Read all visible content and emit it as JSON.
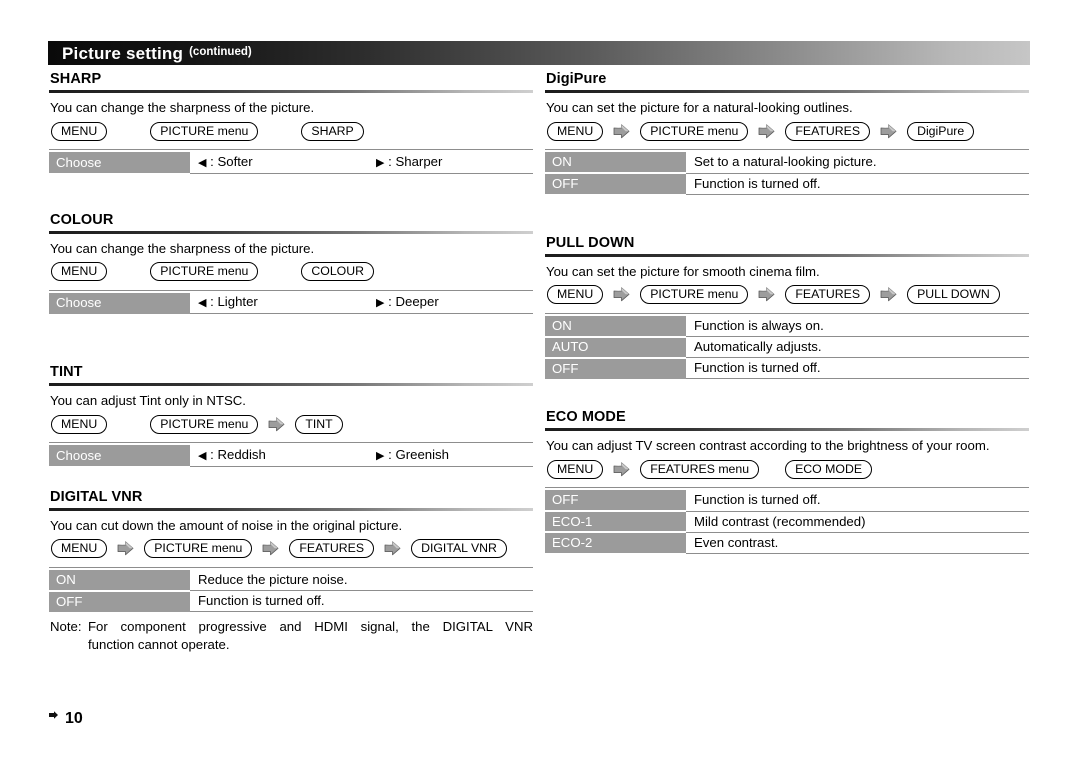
{
  "banner": {
    "title": "Picture setting",
    "subtitle": "(continued)"
  },
  "icons": {
    "arrow": "right-arrow-icon",
    "left_triangle": "◀",
    "right_triangle": "▶",
    "footer_marker": "page-marker-icon"
  },
  "footer": {
    "page_number": "10"
  },
  "left_column": [
    {
      "id": "sharp",
      "heading": "SHARP",
      "description": "You can change the sharpness of the picture.",
      "nav": [
        {
          "label": "MENU",
          "arrow_after": false,
          "gap": "lg"
        },
        {
          "label": "PICTURE menu",
          "arrow_after": false,
          "gap": "lg"
        },
        {
          "label": "SHARP",
          "arrow_after": false,
          "gap": "none"
        }
      ],
      "table_type": "choose",
      "choose_label": "Choose",
      "choose_left": ": Softer",
      "choose_right": ": Sharper"
    },
    {
      "id": "colour",
      "heading": "COLOUR",
      "description": "You can change the sharpness of the picture.",
      "nav": [
        {
          "label": "MENU",
          "arrow_after": false,
          "gap": "lg"
        },
        {
          "label": "PICTURE menu",
          "arrow_after": false,
          "gap": "lg"
        },
        {
          "label": "COLOUR",
          "arrow_after": false,
          "gap": "none"
        }
      ],
      "table_type": "choose",
      "choose_label": "Choose",
      "choose_left": ": Lighter",
      "choose_right": ": Deeper"
    },
    {
      "id": "tint",
      "heading": "TINT",
      "description": "You can adjust Tint only in NTSC.",
      "nav": [
        {
          "label": "MENU",
          "arrow_after": false,
          "gap": "lg"
        },
        {
          "label": "PICTURE menu",
          "arrow_after": true,
          "gap": "sm"
        },
        {
          "label": "TINT",
          "arrow_after": false,
          "gap": "none"
        }
      ],
      "table_type": "choose",
      "choose_label": "Choose",
      "choose_left": ": Reddish",
      "choose_right": ": Greenish"
    },
    {
      "id": "digital-vnr",
      "heading": "DIGITAL VNR",
      "description": "You can cut down the amount of noise in the original picture.",
      "nav": [
        {
          "label": "MENU",
          "arrow_after": true,
          "gap": "sm"
        },
        {
          "label": "PICTURE menu",
          "arrow_after": true,
          "gap": "sm"
        },
        {
          "label": "FEATURES",
          "arrow_after": true,
          "gap": "sm"
        },
        {
          "label": "DIGITAL VNR",
          "arrow_after": false,
          "gap": "none"
        }
      ],
      "table_type": "kv",
      "rows": [
        {
          "key": "ON",
          "value": "Reduce the picture noise."
        },
        {
          "key": "OFF",
          "value": "Function is turned off."
        }
      ],
      "note": {
        "label": "Note:",
        "line1": "For component progressive and HDMI signal, the DIGITAL VNR",
        "line2": "function cannot operate."
      }
    }
  ],
  "right_column": [
    {
      "id": "digipure",
      "heading": "DigiPure",
      "description": "You can set the picture for a natural-looking outlines.",
      "nav": [
        {
          "label": "MENU",
          "arrow_after": true,
          "gap": "sm"
        },
        {
          "label": "PICTURE menu",
          "arrow_after": true,
          "gap": "sm"
        },
        {
          "label": "FEATURES",
          "arrow_after": true,
          "gap": "sm"
        },
        {
          "label": "DigiPure",
          "arrow_after": false,
          "gap": "none"
        }
      ],
      "table_type": "kv",
      "rows": [
        {
          "key": "ON",
          "value": "Set to a natural-looking picture."
        },
        {
          "key": "OFF",
          "value": "Function is turned off."
        }
      ]
    },
    {
      "id": "pull-down",
      "heading": "PULL DOWN",
      "description": "You can set the picture for smooth cinema film.",
      "nav": [
        {
          "label": "MENU",
          "arrow_after": true,
          "gap": "sm"
        },
        {
          "label": "PICTURE menu",
          "arrow_after": true,
          "gap": "sm"
        },
        {
          "label": "FEATURES",
          "arrow_after": true,
          "gap": "sm"
        },
        {
          "label": "PULL DOWN",
          "arrow_after": false,
          "gap": "none"
        }
      ],
      "table_type": "kv",
      "rows": [
        {
          "key": "ON",
          "value": "Function is always on."
        },
        {
          "key": "AUTO",
          "value": "Automatically adjusts."
        },
        {
          "key": "OFF",
          "value": "Function is turned off."
        }
      ]
    },
    {
      "id": "eco-mode",
      "heading": "ECO MODE",
      "description": "You can adjust TV screen contrast according to the brightness of your room.",
      "nav": [
        {
          "label": "MENU",
          "arrow_after": true,
          "gap": "sm"
        },
        {
          "label": "FEATURES menu",
          "arrow_after": false,
          "gap": "md"
        },
        {
          "label": "ECO MODE",
          "arrow_after": false,
          "gap": "none"
        }
      ],
      "table_type": "kv",
      "rows": [
        {
          "key": "OFF",
          "value": "Function is turned off."
        },
        {
          "key": "ECO-1",
          "value": "Mild contrast (recommended)"
        },
        {
          "key": "ECO-2",
          "value": "Even contrast."
        }
      ]
    }
  ],
  "colors": {
    "key_cell_bg": "#9b9b9b",
    "rule_dark": "#1b1b1b",
    "table_line": "#8d8d8d",
    "banner_dark": "#0a0a0a",
    "banner_light": "#c6c6c6"
  }
}
